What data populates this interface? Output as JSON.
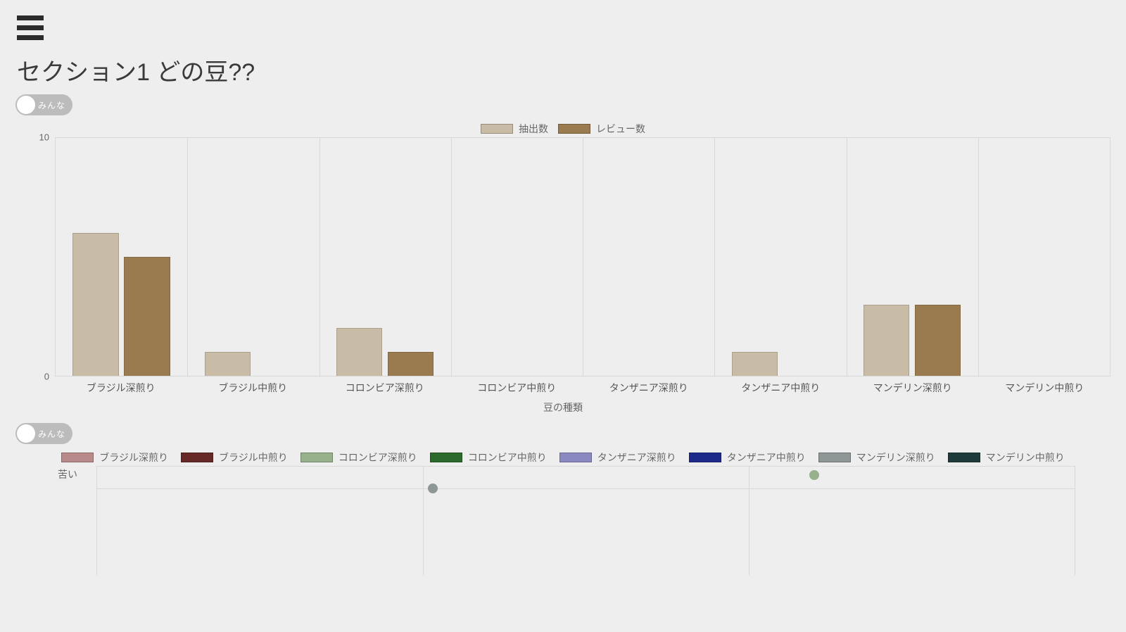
{
  "page": {
    "title": "セクション1 どの豆??"
  },
  "toggle": {
    "label": "みんな"
  },
  "chart_data": [
    {
      "id": "bar",
      "type": "bar",
      "categories": [
        "ブラジル深煎り",
        "ブラジル中煎り",
        "コロンビア深煎り",
        "コロンビア中煎り",
        "タンザニア深煎り",
        "タンザニア中煎り",
        "マンデリン深煎り",
        "マンデリン中煎り"
      ],
      "series": [
        {
          "name": "抽出数",
          "color": "#c9bca6",
          "values": [
            6,
            1,
            2,
            0,
            0,
            1,
            3,
            0
          ]
        },
        {
          "name": "レビュー数",
          "color": "#9a7b4f",
          "values": [
            5,
            0,
            1,
            0,
            0,
            0,
            3,
            0
          ]
        }
      ],
      "ylim": [
        0,
        10
      ],
      "yticks": [
        0,
        10
      ],
      "xlabel": "豆の種類",
      "ylabel": ""
    },
    {
      "id": "scatter",
      "type": "scatter",
      "ytitle": "苦い",
      "legend": [
        {
          "name": "ブラジル深煎り",
          "color": "#b98a8a"
        },
        {
          "name": "ブラジル中煎り",
          "color": "#672828"
        },
        {
          "name": "コロンビア深煎り",
          "color": "#97b18d"
        },
        {
          "name": "コロンビア中煎り",
          "color": "#2d6a2d"
        },
        {
          "name": "タンザニア深煎り",
          "color": "#8a8ac0"
        },
        {
          "name": "タンザニア中煎り",
          "color": "#1e2a8a"
        },
        {
          "name": "マンデリン深煎り",
          "color": "#8f9796"
        },
        {
          "name": "マンデリン中煎り",
          "color": "#1f3a3a"
        }
      ],
      "xlim": [
        0,
        3
      ],
      "ylim": [
        0,
        5
      ],
      "hgrid": [
        4
      ],
      "vgrid": [
        1,
        2
      ],
      "points": [
        {
          "series": "コロンビア深煎り",
          "color": "#97b18d",
          "x": 2.2,
          "y": 4.6
        },
        {
          "series": "マンデリン深煎り",
          "color": "#8f9796",
          "x": 1.03,
          "y": 4.0
        }
      ]
    }
  ]
}
